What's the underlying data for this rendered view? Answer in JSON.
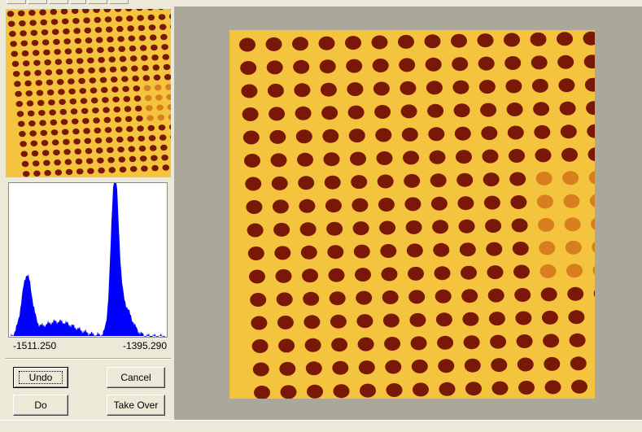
{
  "histogram": {
    "range_min": "-1511.250",
    "range_max": "-1395.290",
    "fill_color": "#0000ff"
  },
  "buttons": {
    "undo_label": "Undo",
    "cancel_label": "Cancel",
    "do_label": "Do",
    "take_over_label": "Take Over"
  },
  "image": {
    "background_color": "#f4c43e",
    "dot_color": "#7a1808",
    "faint_dot_color": "#d06d18",
    "view_bg_color": "#aba89a"
  }
}
